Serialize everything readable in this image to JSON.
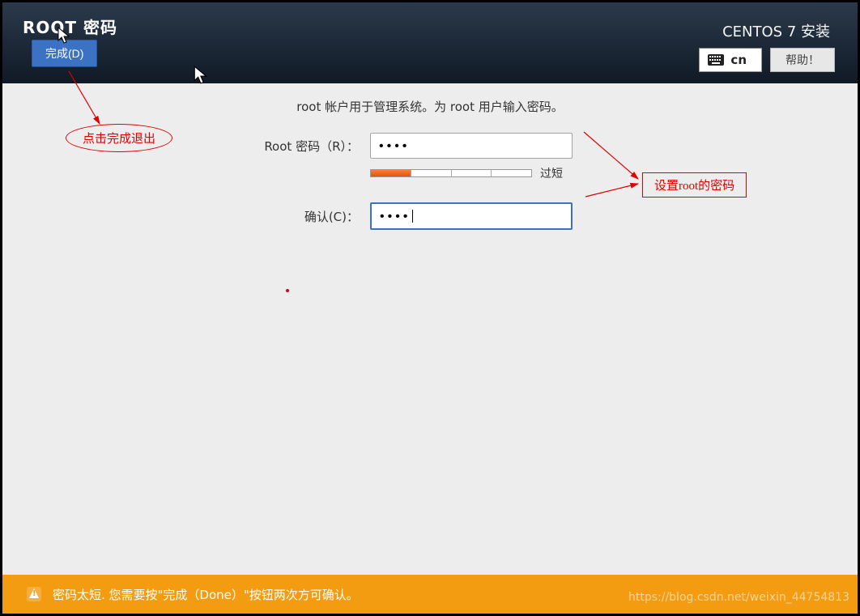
{
  "header": {
    "title_left": "ROOT 密码",
    "done_label": "完成(D)",
    "installer_title": "CENTOS 7 安装",
    "keyboard_layout": "cn",
    "help_label": "帮助！"
  },
  "body": {
    "description": "root 帐户用于管理系统。为 root 用户输入密码。",
    "password_label": "Root 密码（R）：",
    "password_value": "••••",
    "strength_label": "过短",
    "confirm_label": "确认(C)：",
    "confirm_value": "••••"
  },
  "annotations": {
    "left_note": "点击完成退出",
    "right_note": "设置root的密码"
  },
  "footer": {
    "warning_text": "密码太短. 您需要按\"完成（Done）\"按钮两次方可确认。",
    "watermark": "https://blog.csdn.net/weixin_44754813"
  }
}
